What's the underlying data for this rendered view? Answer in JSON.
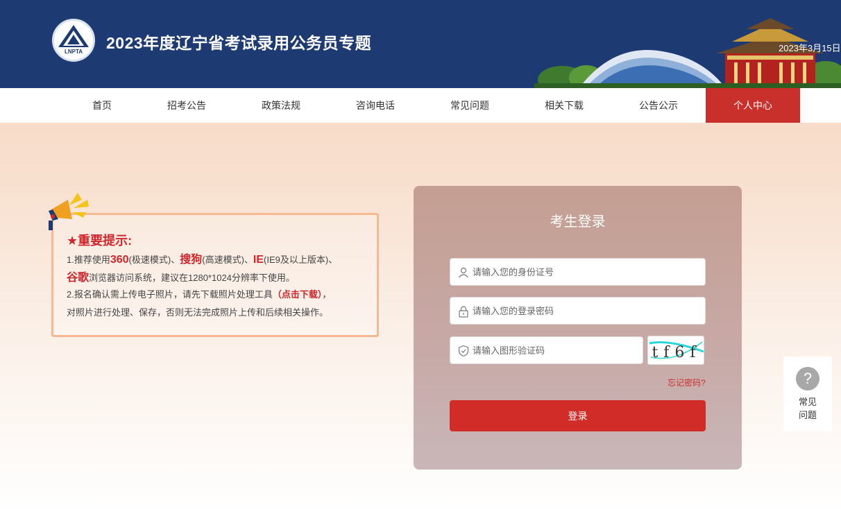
{
  "header": {
    "logo_text": "LNPTA",
    "title": "2023年度辽宁省考试录用公务员专题",
    "date": "2023年3月15日"
  },
  "nav": {
    "items": [
      {
        "label": "首页"
      },
      {
        "label": "招考公告"
      },
      {
        "label": "政策法规"
      },
      {
        "label": "咨询电话"
      },
      {
        "label": "常见问题"
      },
      {
        "label": "相关下载"
      },
      {
        "label": "公告公示"
      },
      {
        "label": "个人中心",
        "active": true
      }
    ]
  },
  "notice": {
    "title": "重要提示:",
    "line1_prefix": "1.推荐使用",
    "browser1": "360",
    "browser1_mode": "(极速模式)、",
    "browser2": "搜狗",
    "browser2_mode": "(高速模式)、",
    "browser3": "IE",
    "browser3_mode": "(IE9及以上版本)、",
    "browser4": "谷歌",
    "line2_suffix": "浏览器访问系统，建议在1280*1024分辨率下使用。",
    "line3_prefix": "2.报名确认需上传电子照片，请先下载照片处理工具",
    "download_link": "（点击下载）",
    "line3_suffix": "，",
    "line4": "对照片进行处理、保存，否则无法完成照片上传和后续相关操作。"
  },
  "login": {
    "title": "考生登录",
    "id_placeholder": "请输入您的身份证号",
    "password_placeholder": "请输入您的登录密码",
    "captcha_placeholder": "请输入图形验证码",
    "captcha_text": "tf6f",
    "forgot": "忘记密码?",
    "submit": "登录"
  },
  "faq_float": {
    "icon": "?",
    "label": "常见问题"
  },
  "colors": {
    "header_bg": "#1e3a72",
    "accent_red": "#c9302c",
    "login_button": "#d12c27"
  }
}
